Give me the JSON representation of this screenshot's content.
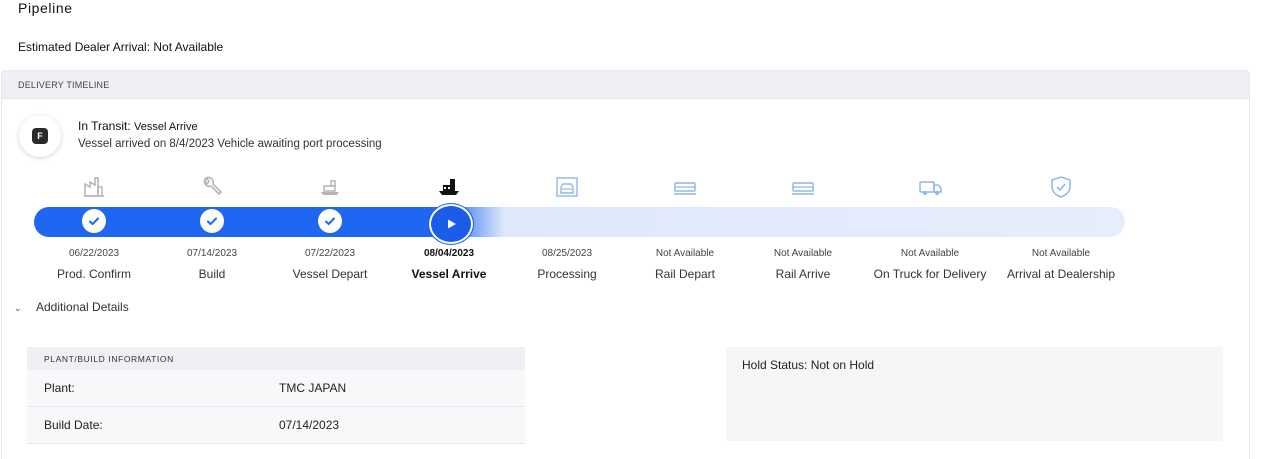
{
  "page": {
    "title": "Pipeline",
    "estimated_arrival": "Estimated Dealer Arrival: Not Available"
  },
  "timeline": {
    "header": "DELIVERY TIMELINE",
    "status_badge": "F",
    "status_prefix": "In Transit: ",
    "status_stage": "Vessel Arrive",
    "status_message": "Vessel arrived on 8/4/2023 Vehicle awaiting port processing",
    "progress_stage_index": 3,
    "stages": [
      {
        "label": "Prod. Confirm",
        "date": "06/22/2023",
        "state": "done",
        "icon": "factory-icon"
      },
      {
        "label": "Build",
        "date": "07/14/2023",
        "state": "done",
        "icon": "wrench-icon"
      },
      {
        "label": "Vessel Depart",
        "date": "07/22/2023",
        "state": "done",
        "icon": "ship-depart-icon"
      },
      {
        "label": "Vessel Arrive",
        "date": "08/04/2023",
        "state": "current",
        "icon": "ship-arrive-icon"
      },
      {
        "label": "Processing",
        "date": "08/25/2023",
        "state": "pending",
        "icon": "processing-icon"
      },
      {
        "label": "Rail Depart",
        "date": "Not Available",
        "state": "pending",
        "icon": "rail-depart-icon"
      },
      {
        "label": "Rail Arrive",
        "date": "Not Available",
        "state": "pending",
        "icon": "rail-arrive-icon"
      },
      {
        "label": "On Truck for Delivery",
        "date": "Not Available",
        "state": "pending",
        "icon": "truck-icon"
      },
      {
        "label": "Arrival at Dealership",
        "date": "Not Available",
        "state": "pending",
        "icon": "shield-check-icon"
      }
    ]
  },
  "details": {
    "toggle_label": "Additional Details",
    "plant_section": {
      "header": "PLANT/BUILD INFORMATION",
      "rows": [
        {
          "key": "Plant:",
          "value": "TMC JAPAN"
        },
        {
          "key": "Build Date:",
          "value": "07/14/2023"
        }
      ]
    },
    "hold_status": "Hold Status: Not on Hold"
  },
  "colors": {
    "progress_blue": "#1f66f2",
    "track_light": "#e6edfc",
    "done_icon": "#b5b5b5",
    "current_icon": "#111111",
    "pending_icon": "#8fb6ea"
  }
}
